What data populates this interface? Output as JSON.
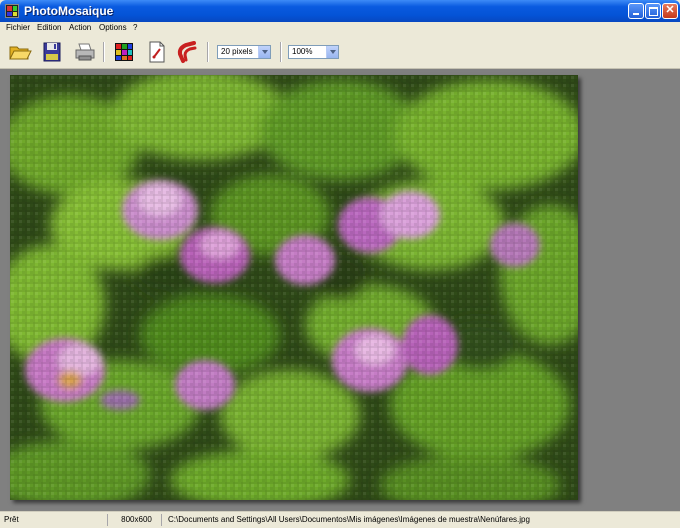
{
  "window": {
    "title": "PhotoMosaique"
  },
  "menu": [
    "Fichier",
    "Edition",
    "Action",
    "Options",
    "?"
  ],
  "toolbar": {
    "buttons": [
      "open-folder-icon",
      "save-disk-icon",
      "print-icon",
      "mosaic-grid-icon",
      "document-icon",
      "magnet-icon"
    ],
    "tile_size": "20 pixels",
    "zoom": "100%"
  },
  "statusbar": {
    "state": "Prêt",
    "dimensions": "800x600",
    "path": "C:\\Documents and Settings\\All Users\\Documentos\\Mis imágenes\\Imágenes de muestra\\Nenúfares.jpg"
  },
  "colors": {
    "title_bar": "#0453D6",
    "workspace": "#808080",
    "foliage": "#4E8A22",
    "flower": "#C46FBF"
  }
}
